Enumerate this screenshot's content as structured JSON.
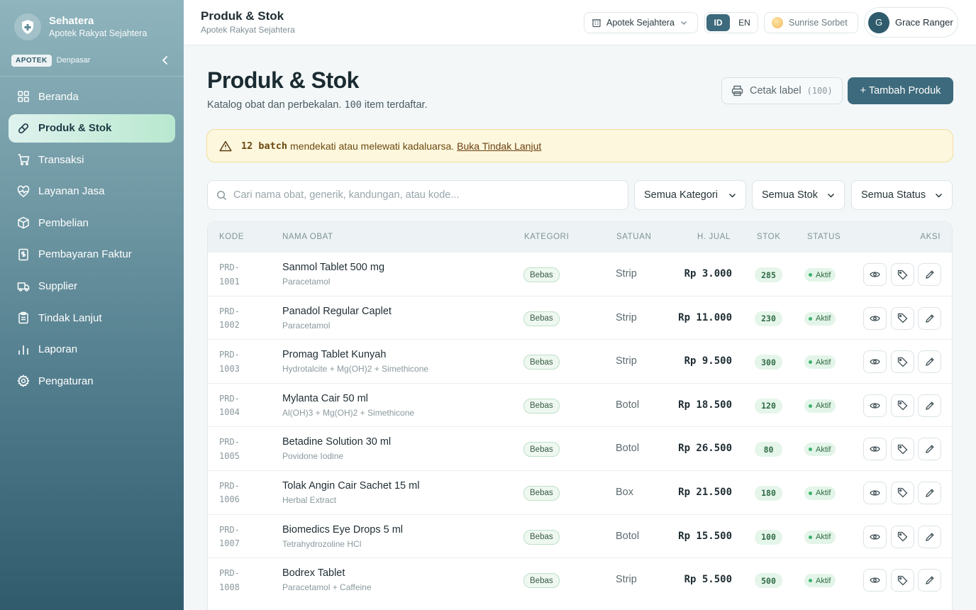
{
  "brand": {
    "name": "Sehatera",
    "subtitle": "Apotek Rakyat Sejahtera",
    "badge": "APOTEK",
    "city": "Denpasar"
  },
  "nav": [
    {
      "label": "Beranda",
      "icon": "grid-icon"
    },
    {
      "label": "Produk & Stok",
      "icon": "pill-icon",
      "active": true
    },
    {
      "label": "Transaksi",
      "icon": "cart-icon"
    },
    {
      "label": "Layanan Jasa",
      "icon": "heart-pulse-icon"
    },
    {
      "label": "Pembelian",
      "icon": "package-icon"
    },
    {
      "label": "Pembayaran Faktur",
      "icon": "invoice-icon"
    },
    {
      "label": "Supplier",
      "icon": "truck-icon"
    },
    {
      "label": "Tindak Lanjut",
      "icon": "clipboard-icon"
    },
    {
      "label": "Laporan",
      "icon": "bar-chart-icon"
    },
    {
      "label": "Pengaturan",
      "icon": "gear-icon"
    }
  ],
  "topbar": {
    "title": "Produk & Stok",
    "subtitle": "Apotek Rakyat Sejahtera",
    "store": "Apotek Sejahtera",
    "lang_id": "ID",
    "lang_en": "EN",
    "theme": "Sunrise Sorbet",
    "user_initial": "G",
    "user_name": "Grace Ranger"
  },
  "page": {
    "title": "Produk & Stok",
    "subtitle_pre": "Katalog obat dan perbekalan.",
    "count": "100",
    "subtitle_post": "item terdaftar.",
    "print_label": "Cetak label",
    "print_count": "(100)",
    "add_label": "+ Tambah Produk"
  },
  "alert": {
    "count": "12 batch",
    "text": "mendekati atau melewati kadaluarsa.",
    "link": "Buka Tindak Lanjut"
  },
  "search": {
    "placeholder": "Cari nama obat, generik, kandungan, atau kode..."
  },
  "filters": {
    "category": "Semua Kategori",
    "stock": "Semua Stok",
    "status": "Semua Status"
  },
  "table": {
    "headers": {
      "code": "KODE",
      "name": "NAMA OBAT",
      "category": "KATEGORI",
      "unit": "SATUAN",
      "price": "H. JUAL",
      "stock": "STOK",
      "status": "STATUS",
      "actions": "AKSI"
    },
    "rows": [
      {
        "code1": "PRD-",
        "code2": "1001",
        "name": "Sanmol Tablet 500 mg",
        "generic": "Paracetamol",
        "category": "Bebas",
        "unit": "Strip",
        "price": "Rp 3.000",
        "stock": "285",
        "status": "Aktif"
      },
      {
        "code1": "PRD-",
        "code2": "1002",
        "name": "Panadol Regular Caplet",
        "generic": "Paracetamol",
        "category": "Bebas",
        "unit": "Strip",
        "price": "Rp 11.000",
        "stock": "230",
        "status": "Aktif"
      },
      {
        "code1": "PRD-",
        "code2": "1003",
        "name": "Promag Tablet Kunyah",
        "generic": "Hydrotalcite + Mg(OH)2 + Simethicone",
        "category": "Bebas",
        "unit": "Strip",
        "price": "Rp 9.500",
        "stock": "300",
        "status": "Aktif"
      },
      {
        "code1": "PRD-",
        "code2": "1004",
        "name": "Mylanta Cair 50 ml",
        "generic": "Al(OH)3 + Mg(OH)2 + Simethicone",
        "category": "Bebas",
        "unit": "Botol",
        "price": "Rp 18.500",
        "stock": "120",
        "status": "Aktif"
      },
      {
        "code1": "PRD-",
        "code2": "1005",
        "name": "Betadine Solution 30 ml",
        "generic": "Povidone Iodine",
        "category": "Bebas",
        "unit": "Botol",
        "price": "Rp 26.500",
        "stock": "80",
        "status": "Aktif"
      },
      {
        "code1": "PRD-",
        "code2": "1006",
        "name": "Tolak Angin Cair Sachet 15 ml",
        "generic": "Herbal Extract",
        "category": "Bebas",
        "unit": "Box",
        "price": "Rp 21.500",
        "stock": "180",
        "status": "Aktif"
      },
      {
        "code1": "PRD-",
        "code2": "1007",
        "name": "Biomedics Eye Drops 5 ml",
        "generic": "Tetrahydrozoline HCl",
        "category": "Bebas",
        "unit": "Botol",
        "price": "Rp 15.500",
        "stock": "100",
        "status": "Aktif"
      },
      {
        "code1": "PRD-",
        "code2": "1008",
        "name": "Bodrex Tablet",
        "generic": "Paracetamol + Caffeine",
        "category": "Bebas",
        "unit": "Strip",
        "price": "Rp 5.500",
        "stock": "500",
        "status": "Aktif"
      }
    ]
  }
}
